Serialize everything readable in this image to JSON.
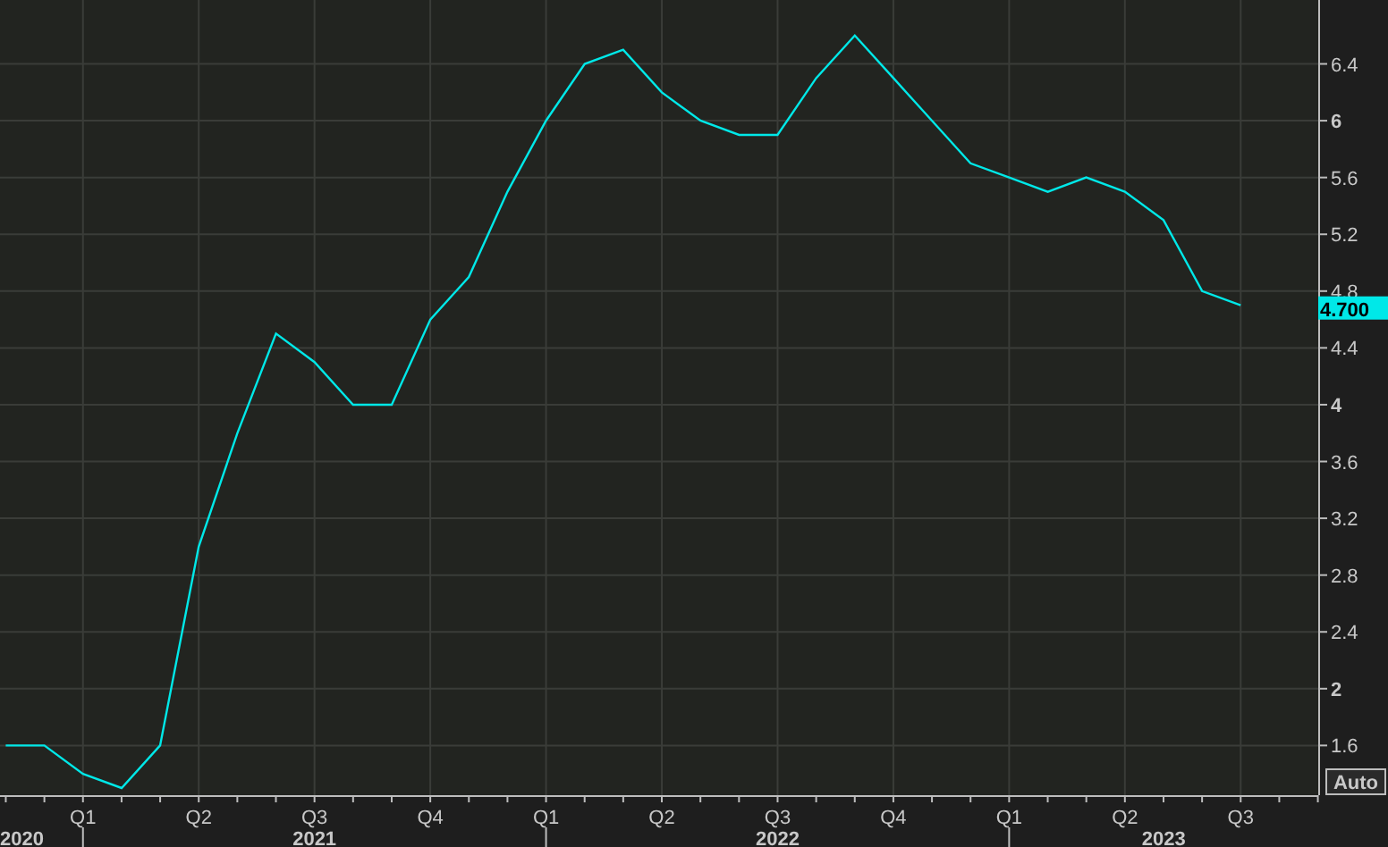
{
  "chart": {
    "chart_data": {
      "type": "line",
      "grid": true,
      "categories": [
        null,
        null,
        "Q1",
        null,
        null,
        "Q2",
        null,
        null,
        "Q3",
        null,
        null,
        "Q4",
        null,
        null,
        "Q1",
        null,
        null,
        "Q2",
        null,
        null,
        "Q3",
        null,
        null,
        "Q4",
        null,
        null,
        "Q1",
        null,
        null,
        "Q2",
        null,
        null,
        "Q3"
      ],
      "series": [
        {
          "color": "#00e8e8",
          "values": [
            1.6,
            1.6,
            1.4,
            1.3,
            1.6,
            3.0,
            3.8,
            4.5,
            4.3,
            4.0,
            4.0,
            4.6,
            4.9,
            5.5,
            6.0,
            6.4,
            6.5,
            6.2,
            6.0,
            5.9,
            5.9,
            6.3,
            6.6,
            6.3,
            6.0,
            5.7,
            5.6,
            5.5,
            5.6,
            5.5,
            5.3,
            4.8,
            4.7
          ]
        }
      ],
      "ylim": [
        1.25,
        6.85
      ],
      "yticks": [
        1.6,
        2,
        2.4,
        2.8,
        3.2,
        3.6,
        4,
        4.4,
        4.8,
        5.2,
        5.6,
        6,
        6.4
      ]
    },
    "year_labels": [
      "2020",
      "2021",
      "2022",
      "2023"
    ],
    "last_value": "4.700",
    "auto_button": "Auto"
  }
}
